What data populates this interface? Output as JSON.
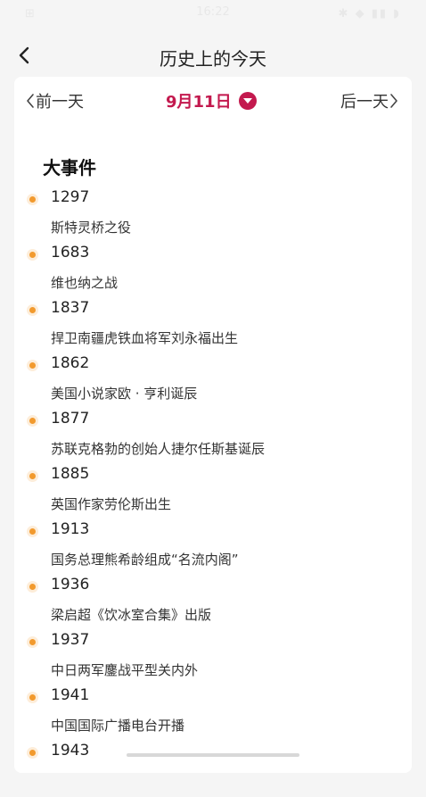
{
  "status_bar": {
    "left": "⊞",
    "time": "16:22",
    "right": "✱ ◆ ▮▮ ◗"
  },
  "header": {
    "title": "历史上的今天",
    "back_icon": "chevron-left-icon"
  },
  "date_nav": {
    "prev_label": "前一天",
    "current_date": "9月11日",
    "next_label": "后一天",
    "accent": "#c3194e"
  },
  "section": {
    "title": "大事件"
  },
  "events": [
    {
      "year": "1297",
      "desc": "斯特灵桥之役"
    },
    {
      "year": "1683",
      "desc": "维也纳之战"
    },
    {
      "year": "1837",
      "desc": "捍卫南疆虎铁血将军刘永福出生"
    },
    {
      "year": "1862",
      "desc": "美国小说家欧 · 亨利诞辰"
    },
    {
      "year": "1877",
      "desc": "苏联克格勃的创始人捷尔任斯基诞辰"
    },
    {
      "year": "1885",
      "desc": "英国作家劳伦斯出生"
    },
    {
      "year": "1913",
      "desc": "国务总理熊希龄组成“名流内阁”"
    },
    {
      "year": "1936",
      "desc": "梁启超《饮冰室合集》出版"
    },
    {
      "year": "1937",
      "desc": "中日两军鏖战平型关内外"
    },
    {
      "year": "1941",
      "desc": "中国国际广播电台开播"
    },
    {
      "year": "1943",
      "desc": ""
    }
  ],
  "colors": {
    "dot": "#f29a2e",
    "background": "#f5f5f5"
  }
}
